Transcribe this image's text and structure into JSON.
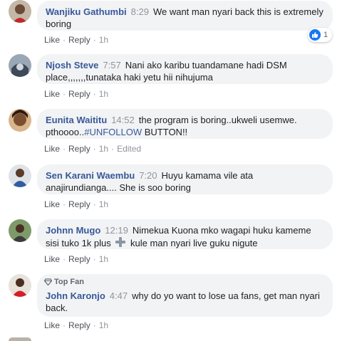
{
  "actions": {
    "like": "Like",
    "reply": "Reply",
    "edited": "Edited"
  },
  "comments": [
    {
      "name": "Wanjiku Gathumbi",
      "time": "8:29",
      "text": "We want man nyari back this is extremely boring",
      "age": "1h",
      "reactions": "1"
    },
    {
      "name": "Njosh Steve",
      "time": "7:57",
      "text": "Nani ako karibu tuandamane hadi DSM place,,,,,,,tunataka haki yetu hii nihujuma",
      "age": "1h"
    },
    {
      "name": "Eunita Waititu",
      "time": "14:52",
      "text_before": "the program is boring..ukweli usemwe. pthoooo..",
      "hashtag": "#UNFOLLOW",
      "text_after": " BUTTON!!",
      "age": "1h"
    },
    {
      "name": "Sen Karani Waembu",
      "time": "7:20",
      "text": "Huyu kamama vile ata anajirundianga.... She is soo boring",
      "age": "1h"
    },
    {
      "name": "Johnn Mugo",
      "time": "12:19",
      "text_before": "Nimekua Kuona mko wagapi huku kameme sisi tuko 1k plus ",
      "text_after": " kule man nyari live guku nigute",
      "age": "1h"
    },
    {
      "badge": "Top Fan",
      "name": "John Karonjo",
      "time": "4:47",
      "text": "why do yo want to lose ua fans, get man nyari back.",
      "age": "1h"
    }
  ],
  "colors": {
    "name": "#385898",
    "bubble": "#f2f3f5",
    "like": "#1877f2",
    "meta": "#90949c"
  }
}
